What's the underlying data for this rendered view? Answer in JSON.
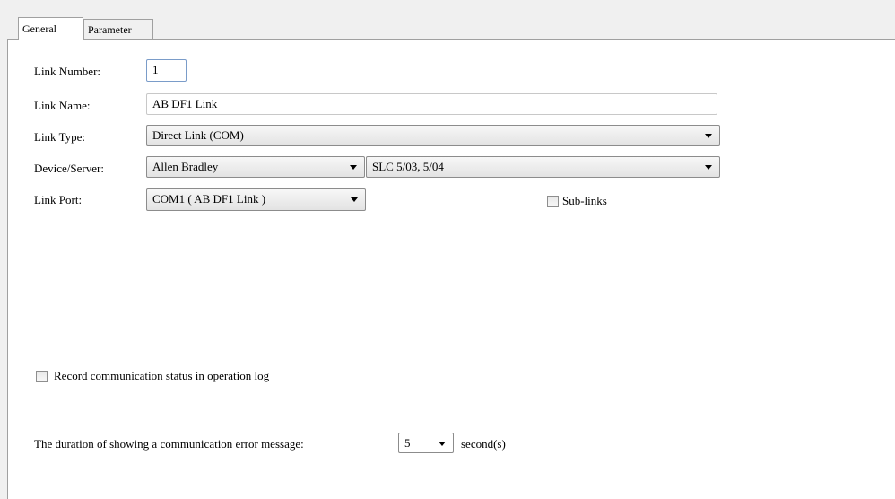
{
  "tabs": {
    "general": "General",
    "parameter": "Parameter"
  },
  "fields": {
    "link_number": {
      "label": "Link Number:",
      "value": "1"
    },
    "link_name": {
      "label": "Link Name:",
      "value": "AB DF1 Link"
    },
    "link_type": {
      "label": "Link Type:",
      "value": "Direct Link (COM)"
    },
    "device_server": {
      "label": "Device/Server:",
      "vendor": "Allen Bradley",
      "model": "SLC 5/03, 5/04"
    },
    "link_port": {
      "label": "Link Port:",
      "value": "COM1 ( AB DF1 Link )"
    }
  },
  "sublinks": {
    "label": "Sub-links",
    "checked": false
  },
  "record_log": {
    "label": "Record communication status in operation log",
    "checked": false
  },
  "duration": {
    "label": "The duration of showing a communication error message:",
    "value": "5",
    "unit": "second(s)"
  }
}
